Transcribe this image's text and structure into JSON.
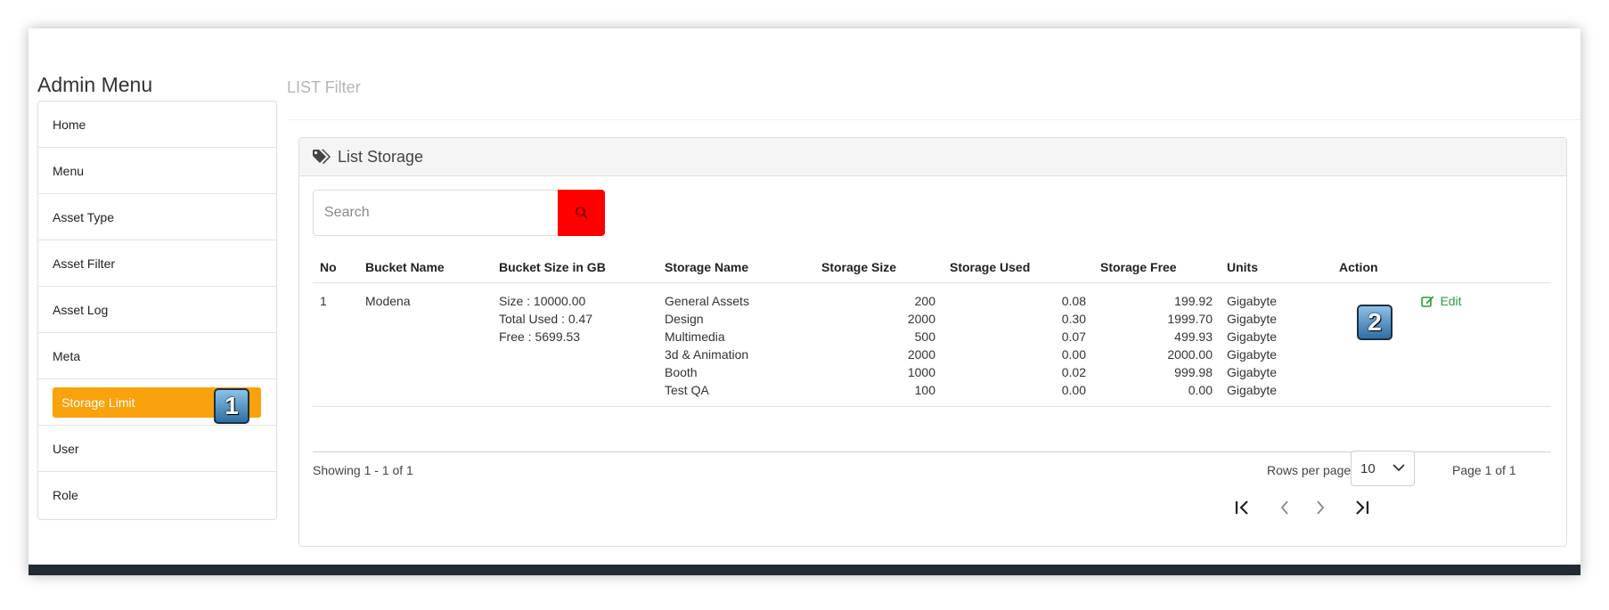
{
  "sidebar": {
    "title": "Admin Menu",
    "items": [
      {
        "label": "Home"
      },
      {
        "label": "Menu"
      },
      {
        "label": "Asset Type"
      },
      {
        "label": "Asset Filter"
      },
      {
        "label": "Asset Log"
      },
      {
        "label": "Meta"
      },
      {
        "label": "Storage Limit",
        "active": true
      },
      {
        "label": "User"
      },
      {
        "label": "Role"
      }
    ]
  },
  "markers": {
    "one": "1",
    "two": "2"
  },
  "header": {
    "filter_title": "LIST Filter"
  },
  "panel": {
    "title": "List Storage",
    "tag_icon": "tags-icon",
    "search": {
      "placeholder": "Search",
      "value": "",
      "icon": "search-icon",
      "button_color": "#ff0000"
    },
    "columns": [
      "No",
      "Bucket Name",
      "Bucket Size in GB",
      "Storage Name",
      "Storage Size",
      "Storage Used",
      "Storage Free",
      "Units",
      "Action"
    ],
    "row": {
      "no": "1",
      "bucket_name": "Modena",
      "bucket_size": [
        "Size : 10000.00",
        "Total Used : 0.47",
        "Free : 5699.53"
      ],
      "storage_names": [
        "General Assets",
        "Design",
        "Multimedia",
        "3d & Animation",
        "Booth",
        "Test QA"
      ],
      "storage_sizes": [
        "200",
        "2000",
        "500",
        "2000",
        "1000",
        "100"
      ],
      "storage_used": [
        "0.08",
        "0.30",
        "0.07",
        "0.00",
        "0.02",
        "0.00"
      ],
      "storage_free": [
        "199.92",
        "1999.70",
        "499.93",
        "2000.00",
        "999.98",
        "0.00"
      ],
      "units": [
        "Gigabyte",
        "Gigabyte",
        "Gigabyte",
        "Gigabyte",
        "Gigabyte",
        "Gigabyte"
      ],
      "action_label": "Edit",
      "action_icon": "edit-icon"
    },
    "footer": {
      "showing": "Showing 1 - 1 of 1",
      "rows_per_page_label": "Rows per page",
      "rows_per_page_value": "10",
      "page_label": "Page 1 of 1"
    }
  },
  "colors": {
    "active_menu": "#f9a20c",
    "edit_link": "#2e9a3c",
    "footer_bar": "#232a33"
  }
}
